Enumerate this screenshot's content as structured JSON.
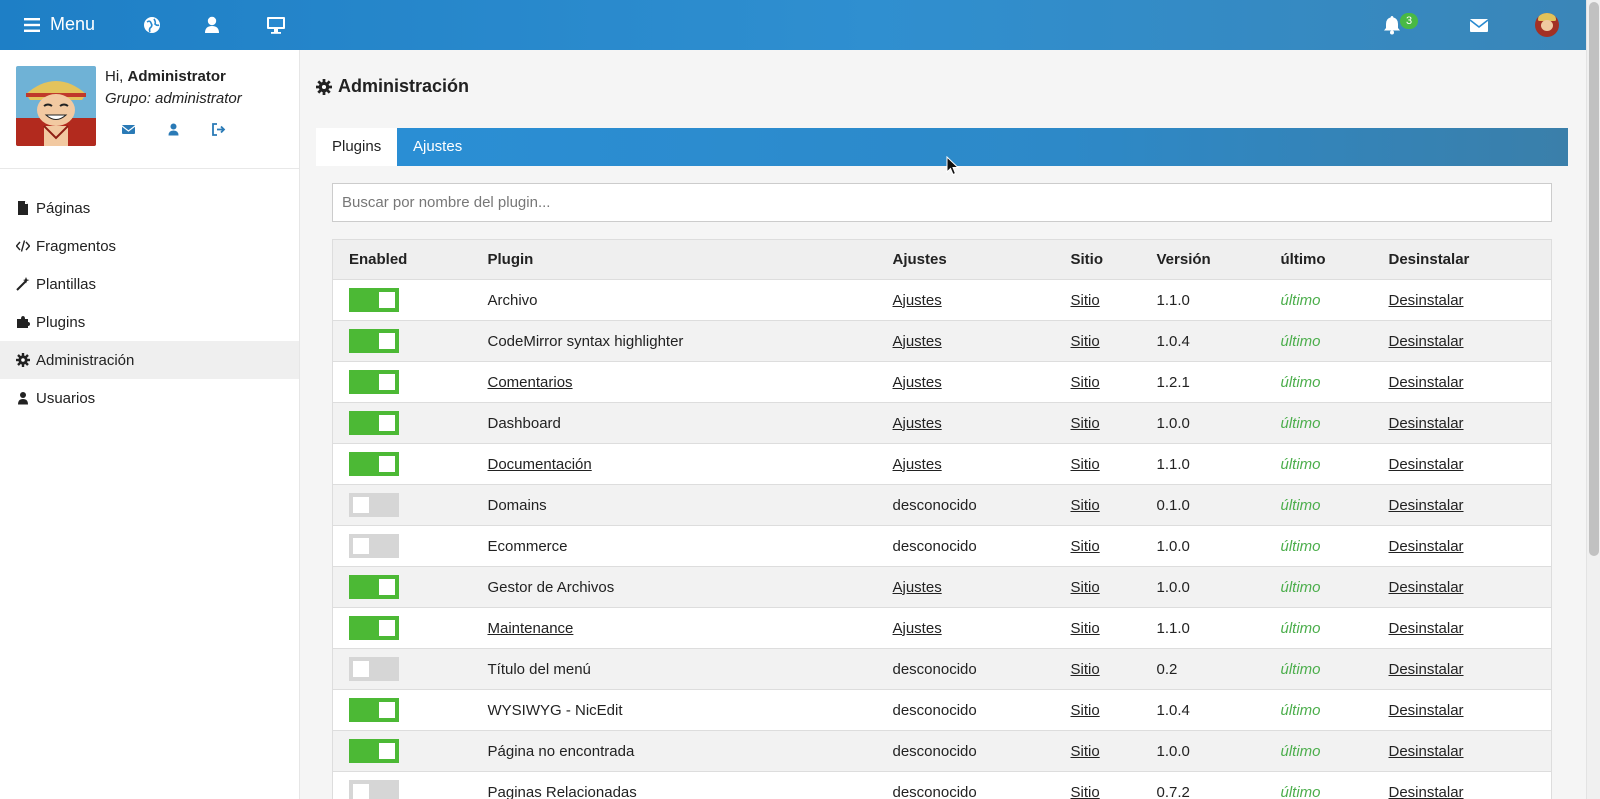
{
  "topbar": {
    "menu_label": "Menu",
    "notification_count": "3",
    "icons": [
      "bars-icon",
      "globe-icon",
      "user-icon",
      "desktop-icon",
      "bell-icon",
      "envelope-icon",
      "avatar"
    ]
  },
  "sidebar": {
    "greeting_prefix": "Hi,",
    "user_name": "Administrator",
    "group_text": "Grupo: administrator",
    "nav": [
      {
        "label": "Páginas",
        "icon": "file-icon"
      },
      {
        "label": "Fragmentos",
        "icon": "code-icon"
      },
      {
        "label": "Plantillas",
        "icon": "magic-wand-icon"
      },
      {
        "label": "Plugins",
        "icon": "puzzle-icon"
      },
      {
        "label": "Administración",
        "icon": "gear-icon",
        "active": true
      },
      {
        "label": "Usuarios",
        "icon": "user-icon"
      }
    ]
  },
  "main": {
    "title": "Administración",
    "tabs": [
      {
        "label": "Plugins",
        "active": true
      },
      {
        "label": "Ajustes",
        "active": false
      }
    ],
    "search_placeholder": "Buscar por nombre del plugin..."
  },
  "table": {
    "headers": [
      "Enabled",
      "Plugin",
      "Ajustes",
      "Sitio",
      "Versión",
      "último",
      "Desinstalar"
    ],
    "rows": [
      {
        "enabled": true,
        "plugin": "Archivo",
        "plugin_link": false,
        "settings": "Ajustes",
        "settings_link": true,
        "site": "Sitio",
        "version": "1.1.0",
        "latest": "último",
        "uninstall": "Desinstalar"
      },
      {
        "enabled": true,
        "plugin": "CodeMirror syntax highlighter",
        "plugin_link": false,
        "settings": "Ajustes",
        "settings_link": true,
        "site": "Sitio",
        "version": "1.0.4",
        "latest": "último",
        "uninstall": "Desinstalar"
      },
      {
        "enabled": true,
        "plugin": "Comentarios",
        "plugin_link": true,
        "settings": "Ajustes",
        "settings_link": true,
        "site": "Sitio",
        "version": "1.2.1",
        "latest": "último",
        "uninstall": "Desinstalar"
      },
      {
        "enabled": true,
        "plugin": "Dashboard",
        "plugin_link": false,
        "settings": "Ajustes",
        "settings_link": true,
        "site": "Sitio",
        "version": "1.0.0",
        "latest": "último",
        "uninstall": "Desinstalar"
      },
      {
        "enabled": true,
        "plugin": "Documentación",
        "plugin_link": true,
        "settings": "Ajustes",
        "settings_link": true,
        "site": "Sitio",
        "version": "1.1.0",
        "latest": "último",
        "uninstall": "Desinstalar"
      },
      {
        "enabled": false,
        "plugin": "Domains",
        "plugin_link": false,
        "settings": "desconocido",
        "settings_link": false,
        "site": "Sitio",
        "version": "0.1.0",
        "latest": "último",
        "uninstall": "Desinstalar"
      },
      {
        "enabled": false,
        "plugin": "Ecommerce",
        "plugin_link": false,
        "settings": "desconocido",
        "settings_link": false,
        "site": "Sitio",
        "version": "1.0.0",
        "latest": "último",
        "uninstall": "Desinstalar"
      },
      {
        "enabled": true,
        "plugin": "Gestor de Archivos",
        "plugin_link": false,
        "settings": "Ajustes",
        "settings_link": true,
        "site": "Sitio",
        "version": "1.0.0",
        "latest": "último",
        "uninstall": "Desinstalar"
      },
      {
        "enabled": true,
        "plugin": "Maintenance",
        "plugin_link": true,
        "settings": "Ajustes",
        "settings_link": true,
        "site": "Sitio",
        "version": "1.1.0",
        "latest": "último",
        "uninstall": "Desinstalar"
      },
      {
        "enabled": false,
        "plugin": "Título del menú",
        "plugin_link": false,
        "settings": "desconocido",
        "settings_link": false,
        "site": "Sitio",
        "version": "0.2",
        "latest": "último",
        "uninstall": "Desinstalar"
      },
      {
        "enabled": true,
        "plugin": "WYSIWYG - NicEdit",
        "plugin_link": false,
        "settings": "desconocido",
        "settings_link": false,
        "site": "Sitio",
        "version": "1.0.4",
        "latest": "último",
        "uninstall": "Desinstalar"
      },
      {
        "enabled": true,
        "plugin": "Página no encontrada",
        "plugin_link": false,
        "settings": "desconocido",
        "settings_link": false,
        "site": "Sitio",
        "version": "1.0.0",
        "latest": "último",
        "uninstall": "Desinstalar"
      },
      {
        "enabled": false,
        "plugin": "Paginas Relacionadas",
        "plugin_link": false,
        "settings": "desconocido",
        "settings_link": false,
        "site": "Sitio",
        "version": "0.7.2",
        "latest": "último",
        "uninstall": "Desinstalar"
      }
    ]
  },
  "colors": {
    "topbar": "#2489cc",
    "toggle_on": "#4cb935",
    "toggle_off": "#d6d6d6",
    "latest": "#4cae4c",
    "badge": "#49b944"
  }
}
